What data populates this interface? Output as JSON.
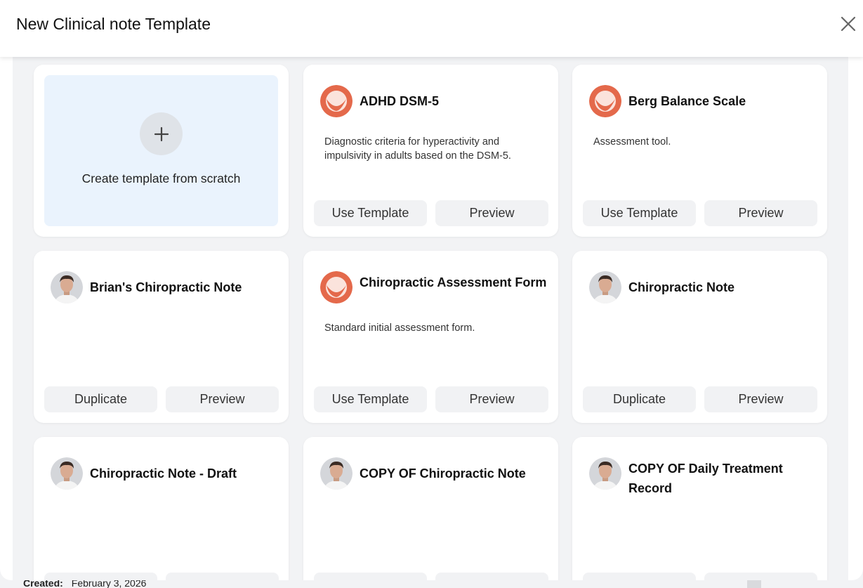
{
  "background": {
    "created_label": "Created:",
    "created_value": "February 3, 2026"
  },
  "modal": {
    "title": "New Clinical note Template",
    "close_icon": "close-icon"
  },
  "scratch_card": {
    "icon": "plus-icon",
    "label": "Create template from scratch"
  },
  "cards": [
    {
      "title": "ADHD DSM-5",
      "icon": "brand-logo-icon",
      "description": "Diagnostic criteria for hyperactivity and impulsivity in adults based on the DSM-5.",
      "primary_button": "Use Template",
      "secondary_button": "Preview"
    },
    {
      "title": "Berg Balance Scale",
      "icon": "brand-logo-icon",
      "description": "Assessment tool.",
      "primary_button": "Use Template",
      "secondary_button": "Preview"
    },
    {
      "title": "Brian's Chiropractic Note",
      "icon": "user-avatar",
      "description": "",
      "primary_button": "Duplicate",
      "secondary_button": "Preview"
    },
    {
      "title": "Chiropractic Assessment Form",
      "icon": "brand-logo-icon",
      "description": "Standard initial assessment form.",
      "primary_button": "Use Template",
      "secondary_button": "Preview"
    },
    {
      "title": "Chiropractic Note",
      "icon": "user-avatar",
      "description": "",
      "primary_button": "Duplicate",
      "secondary_button": "Preview"
    },
    {
      "title": "Chiropractic Note - Draft",
      "icon": "user-avatar",
      "description": ""
    },
    {
      "title": "COPY OF Chiropractic Note",
      "icon": "user-avatar",
      "description": ""
    },
    {
      "title": "COPY OF Daily Treatment Record",
      "icon": "user-avatar",
      "description": ""
    }
  ],
  "colors": {
    "brand_orange": "#e4694b",
    "scratch_bg": "#eaf3fd",
    "body_bg": "#f2f3f5",
    "button_bg": "#f1f2f4"
  }
}
